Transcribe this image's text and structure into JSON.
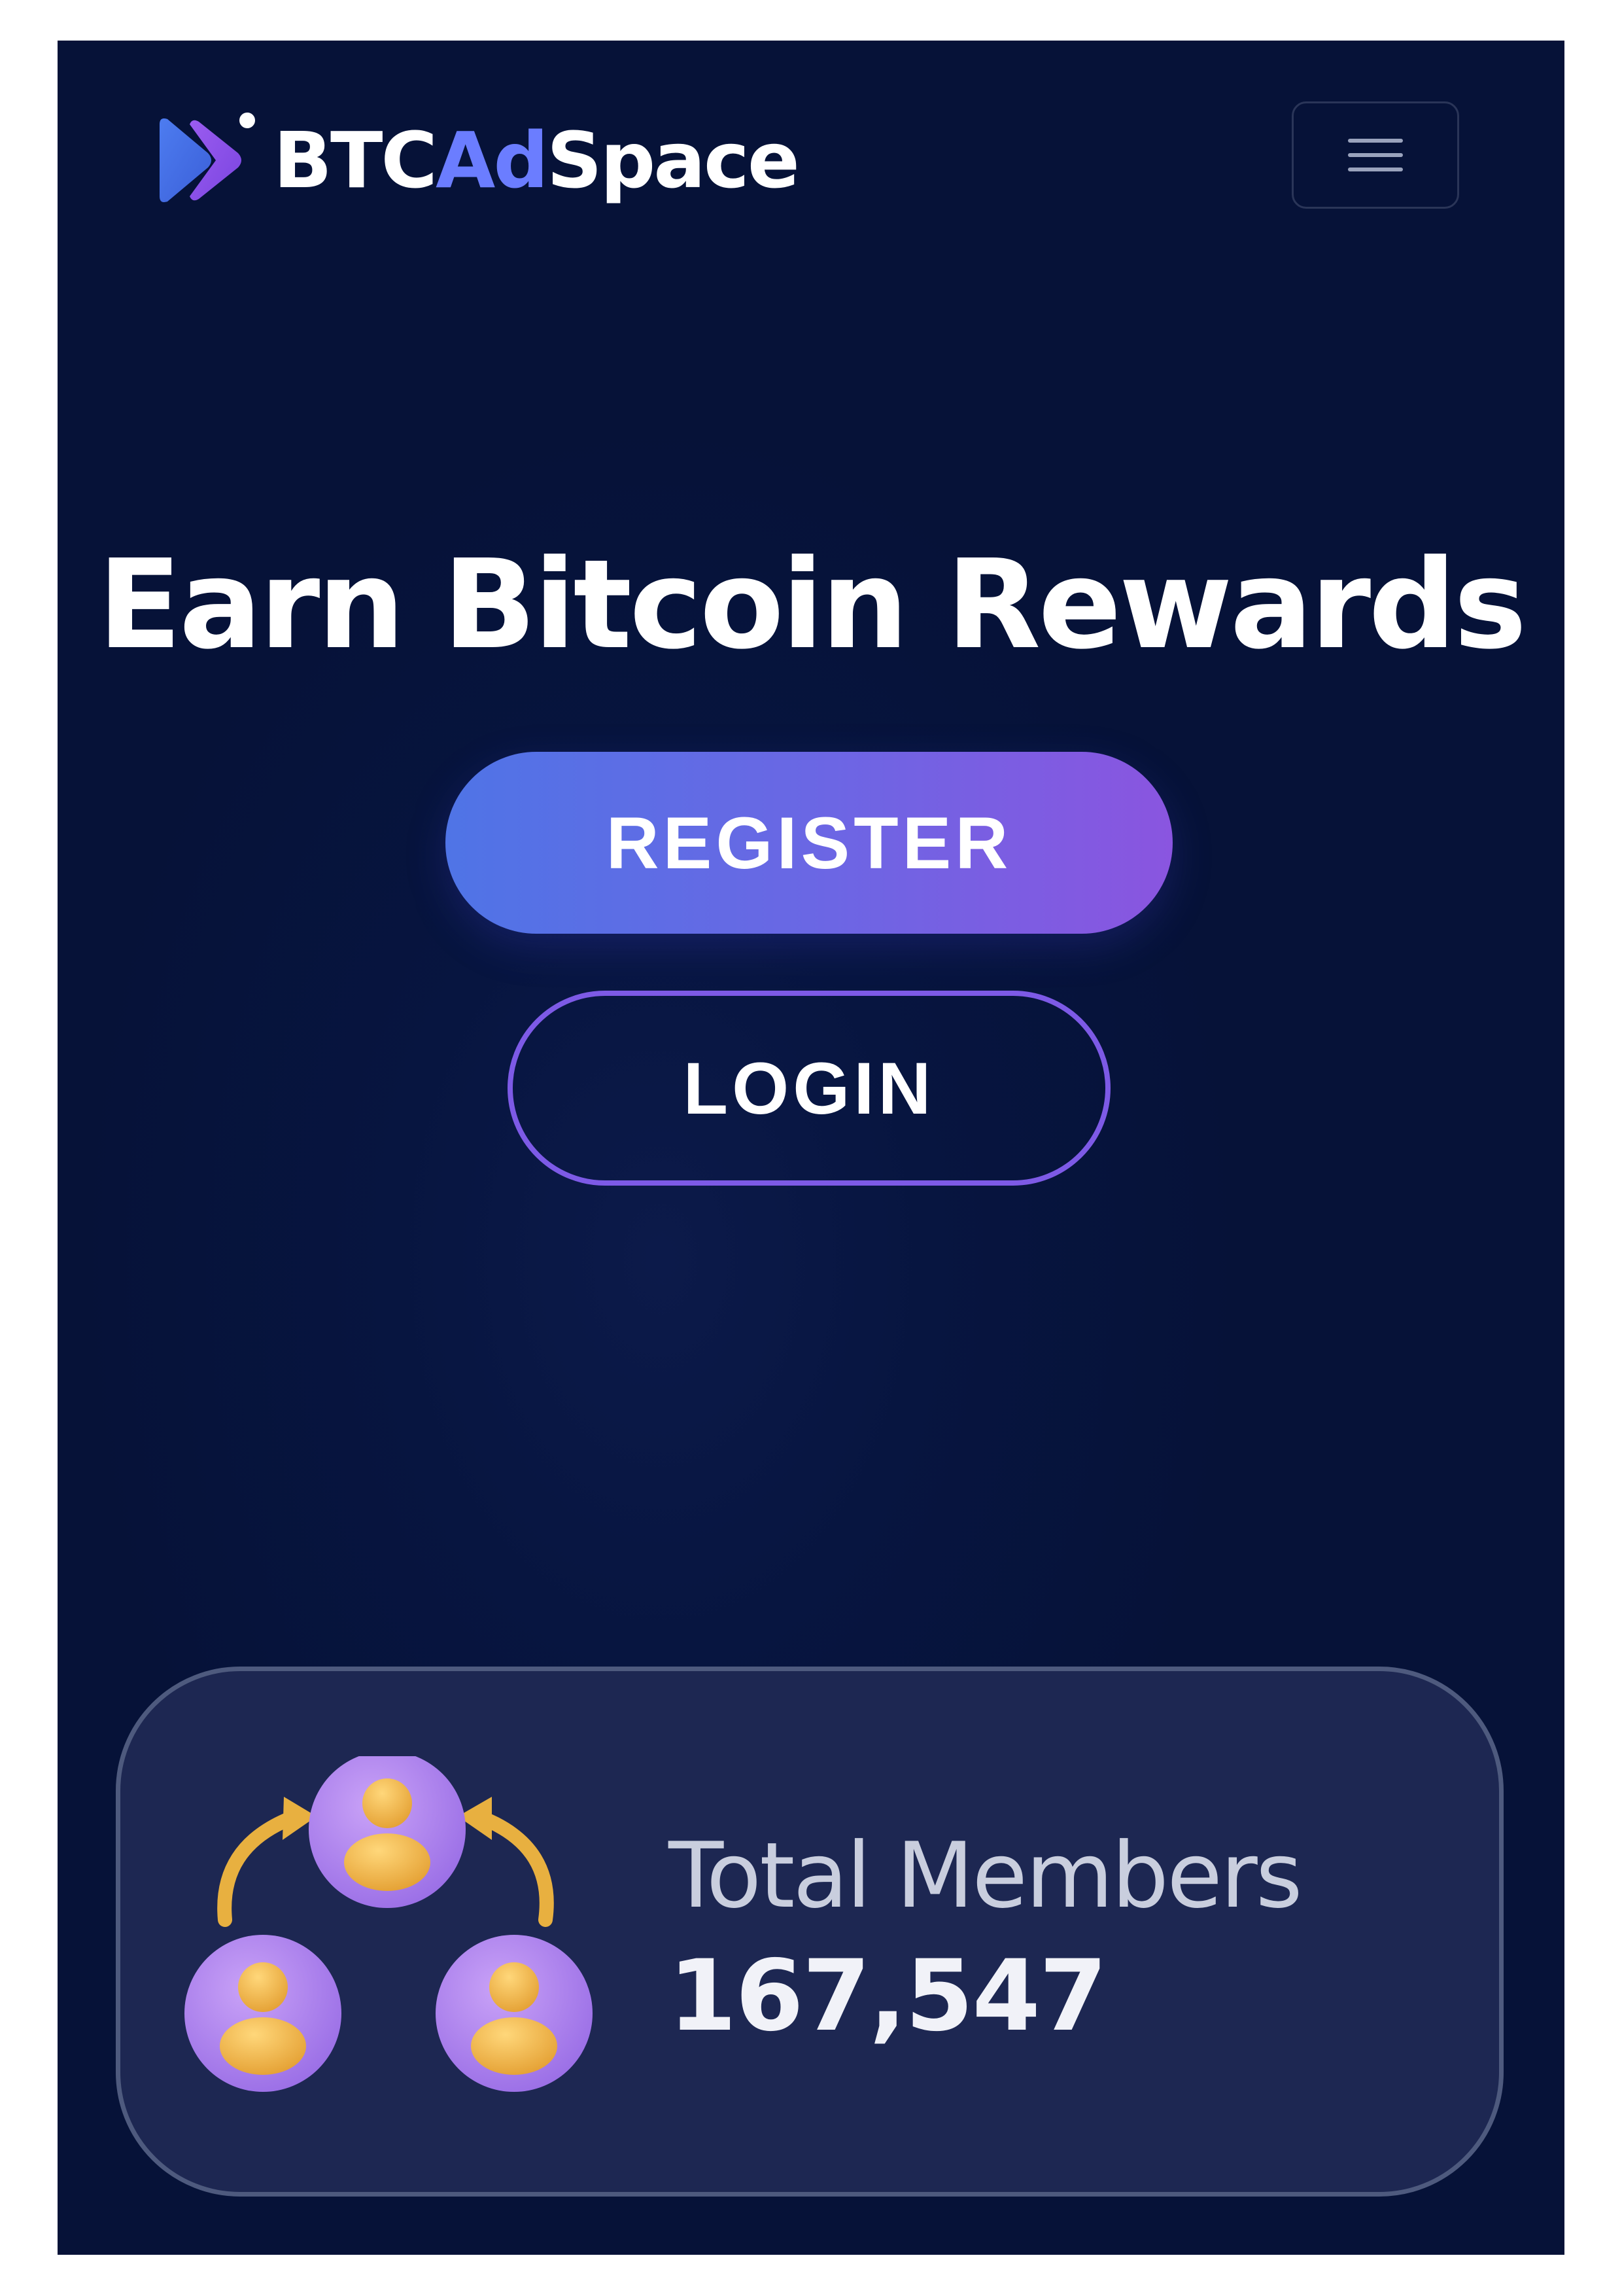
{
  "header": {
    "logo_text_part1": "BTC",
    "logo_text_accent": "Ad",
    "logo_text_part2": "Space",
    "logo_icon": "chevron-forward-logo-icon",
    "menu_icon": "hamburger-menu-icon"
  },
  "hero": {
    "title": "Earn Bitcoin Rewards",
    "register_label": "REGISTER",
    "login_label": "LOGIN"
  },
  "stats": {
    "label": "Total Members",
    "value": "167,547",
    "icon": "members-referral-icon"
  },
  "colors": {
    "background": "#061238",
    "accent_blue": "#6b7dff",
    "register_gradient_start": "#4f74e6",
    "register_gradient_end": "#8a55e0",
    "login_border": "#7d5ae6",
    "card_background": "#1d2752",
    "avatar_purple": "#b084f0",
    "avatar_gold": "#f0b84a"
  }
}
